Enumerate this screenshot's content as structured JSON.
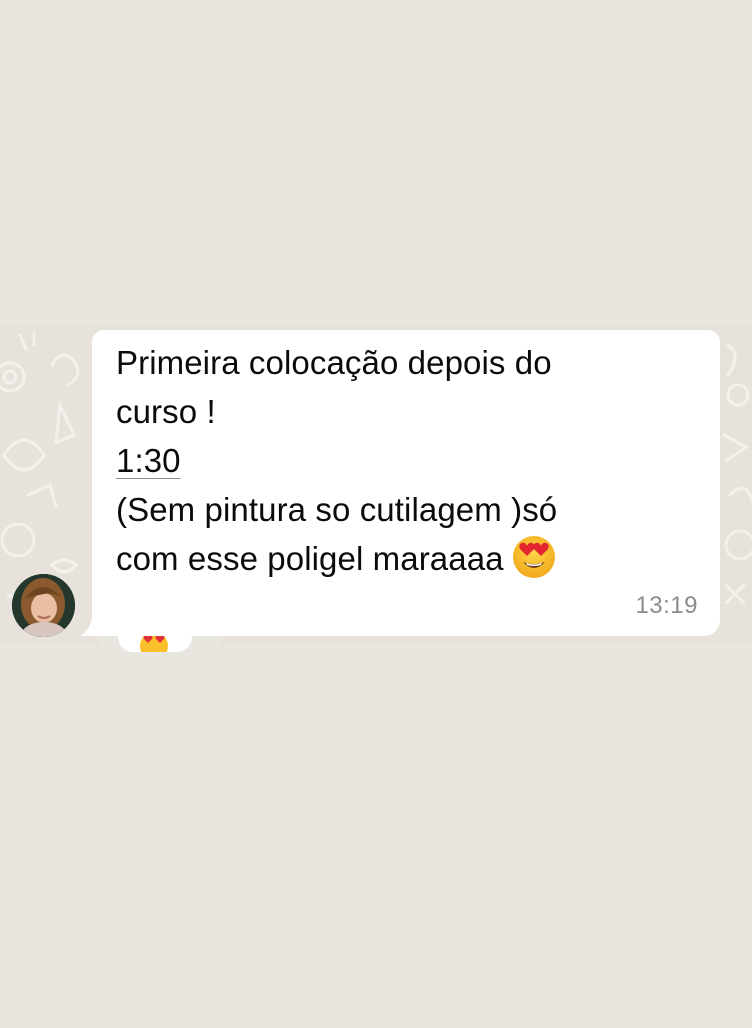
{
  "message": {
    "lines": [
      "Primeira colocação depois do",
      "curso !",
      "1:30",
      "(Sem pintura so cutilagem )só",
      "com esse poligel maraaaa"
    ],
    "emoji": "heart-eyes-emoji",
    "time": "13:19"
  },
  "reaction": {
    "emoji": "heart-eyes-emoji"
  },
  "colors": {
    "background": "#e9e6e0",
    "bubble": "#ffffff",
    "text": "#0b0b0b",
    "timestamp": "#8c8c8c"
  }
}
